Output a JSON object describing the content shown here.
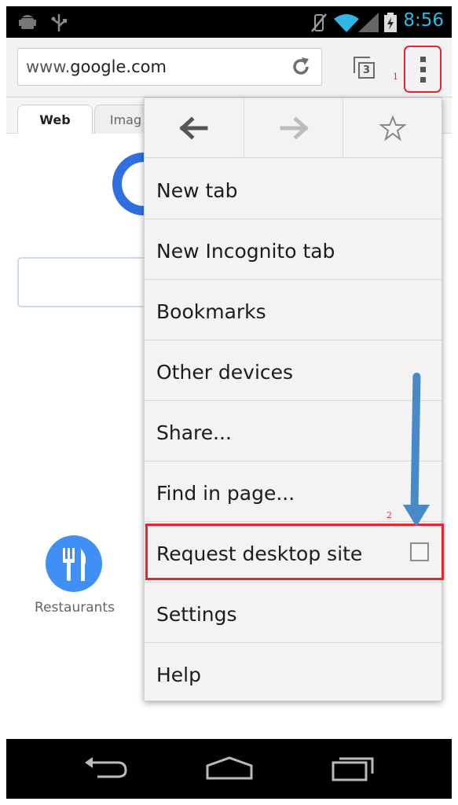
{
  "status_bar": {
    "time": "8:56"
  },
  "toolbar": {
    "url_prefix": "www.",
    "url_main": "google.com",
    "tab_count": "3",
    "menu_annotation": "1"
  },
  "page": {
    "tabs": [
      {
        "label": "Web"
      },
      {
        "label": "Imag"
      }
    ],
    "restaurants_label": "Restaurants"
  },
  "menu": {
    "items": [
      {
        "label": "New tab"
      },
      {
        "label": "New Incognito tab"
      },
      {
        "label": "Bookmarks"
      },
      {
        "label": "Other devices"
      },
      {
        "label": "Share..."
      },
      {
        "label": "Find in page..."
      },
      {
        "label": "Request desktop site",
        "checked": false
      },
      {
        "label": "Settings"
      },
      {
        "label": "Help"
      }
    ],
    "highlight_annotation": "2"
  },
  "colors": {
    "accent": "#33b5e5",
    "annotation": "#e8242c",
    "arrow": "#4a89c8"
  }
}
